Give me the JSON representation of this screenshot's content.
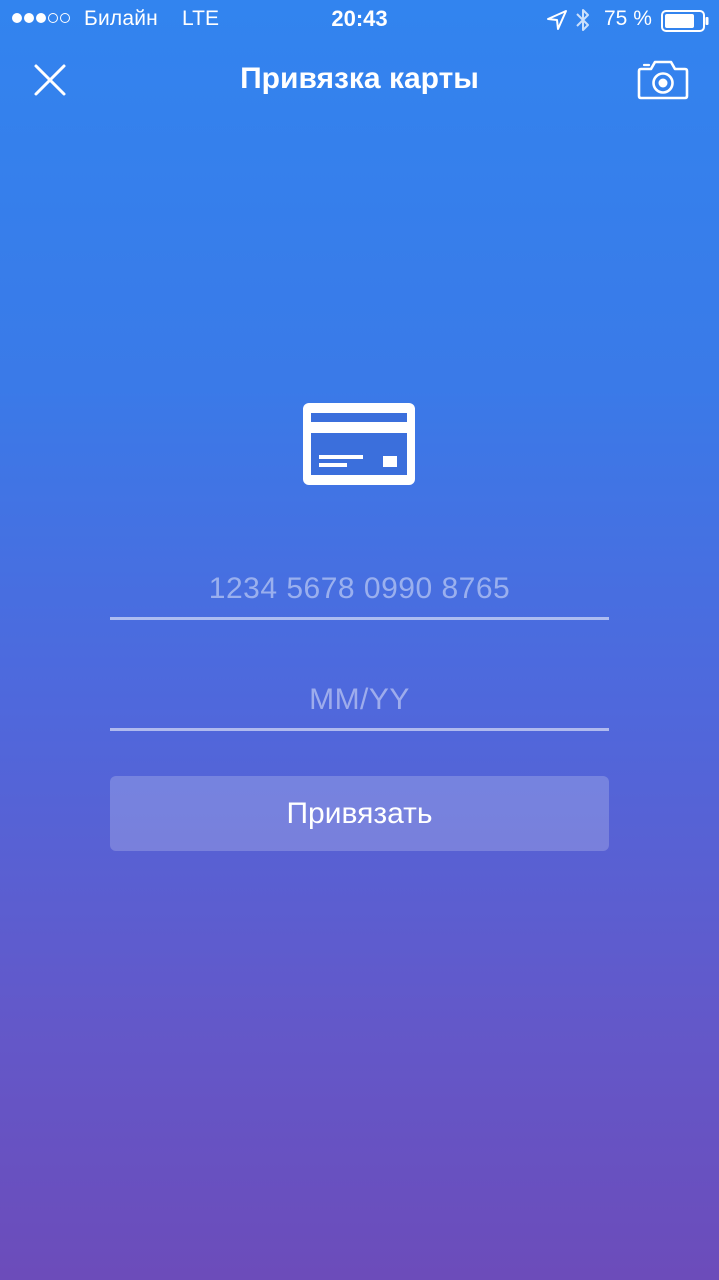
{
  "status_bar": {
    "carrier": "Билайн",
    "network": "LTE",
    "time": "20:43",
    "battery_percent": "75 %",
    "signal_bars_filled": 3,
    "signal_bars_total": 5,
    "battery_level": 0.75,
    "icons": [
      "location-arrow-icon",
      "bluetooth-icon",
      "battery-icon"
    ]
  },
  "nav": {
    "title": "Привязка карты",
    "close_icon": "close-icon",
    "camera_icon": "camera-icon"
  },
  "card_icon": "credit-card-icon",
  "form": {
    "card_number_placeholder": "1234 5678 0990 8765",
    "card_number_value": "",
    "expiry_placeholder": "MM/YY",
    "expiry_value": "",
    "submit_label": "Привязать"
  },
  "colors": {
    "gradient_top": "#3284ef",
    "gradient_bottom": "#6c4cba",
    "card_stripe": "#3b6fdc"
  }
}
